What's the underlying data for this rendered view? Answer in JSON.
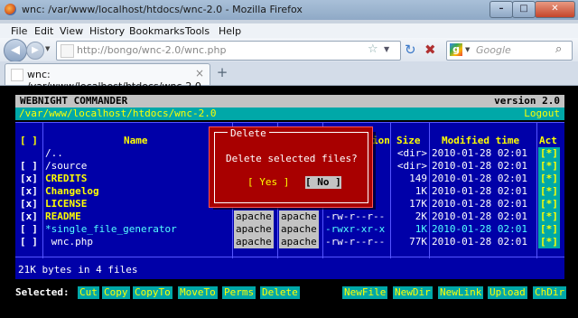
{
  "window": {
    "title": "wnc: /var/www/localhost/htdocs/wnc-2.0 - Mozilla Firefox",
    "min": "–",
    "max": "□",
    "close": "✕"
  },
  "menu": [
    "File",
    "Edit",
    "View",
    "History",
    "Bookmarks",
    "Tools",
    "Help"
  ],
  "nav": {
    "url": "http://bongo/wnc-2.0/wnc.php",
    "search_placeholder": "Google",
    "back": "◀",
    "forward": "▶",
    "reload": "↻",
    "stop": "✖"
  },
  "tab": {
    "label": "wnc: /var/www/localhost/htdocs/wnc-2.0",
    "close": "×",
    "new": "+"
  },
  "app": {
    "name": "WEBNIGHT COMMANDER",
    "version": "version 2.0",
    "path": "/var/www/localhost/htdocs/wnc-2.0",
    "logout": "Logout",
    "columns": {
      "sel": "[ ]",
      "name": "Name",
      "perm": "ion",
      "size": "Size",
      "modified": "Modified time",
      "act": "Act"
    },
    "rows": [
      {
        "sel": "",
        "name": "/..",
        "owner": "",
        "group": "",
        "perm": "-x",
        "size": "<dir>",
        "modified": "2010-01-28 02:01",
        "act": "[*]",
        "style": "plain"
      },
      {
        "sel": "[ ]",
        "name": "/source",
        "owner": "",
        "group": "",
        "perm": "-x",
        "size": "<dir>",
        "modified": "2010-01-28 02:01",
        "act": "[*]",
        "style": "plain"
      },
      {
        "sel": "[x]",
        "name": "CREDITS",
        "owner": "",
        "group": "",
        "perm": "--",
        "size": "149",
        "modified": "2010-01-28 02:01",
        "act": "[*]",
        "style": "fn"
      },
      {
        "sel": "[x]",
        "name": "Changelog",
        "owner": "",
        "group": "",
        "perm": "--",
        "size": "1K",
        "modified": "2010-01-28 02:01",
        "act": "[*]",
        "style": "fn"
      },
      {
        "sel": "[x]",
        "name": "LICENSE",
        "owner": "",
        "group": "",
        "perm": "--",
        "size": "17K",
        "modified": "2010-01-28 02:01",
        "act": "[*]",
        "style": "fn"
      },
      {
        "sel": "[x]",
        "name": "README",
        "owner": "apache",
        "group": "apache",
        "perm": "-rw-r--r--",
        "size": "2K",
        "modified": "2010-01-28 02:01",
        "act": "[*]",
        "style": "fn"
      },
      {
        "sel": "[ ]",
        "name": "*single_file_generator",
        "owner": "apache",
        "group": "apache",
        "perm": "-rwxr-xr-x",
        "size": "1K",
        "modified": "2010-01-28 02:01",
        "act": "[*]",
        "style": "cyan"
      },
      {
        "sel": "[ ]",
        "name": " wnc.php",
        "owner": "apache",
        "group": "apache",
        "perm": "-rw-r--r--",
        "size": "77K",
        "modified": "2010-01-28 02:01",
        "act": "[*]",
        "style": "plain"
      }
    ],
    "info": "21K bytes in 4 files",
    "dialog": {
      "title": "Delete",
      "message": "Delete selected files?",
      "yes": "[ Yes ]",
      "no": "[ No ]"
    },
    "bottom": {
      "label": "Selected:",
      "left_buttons": [
        "Cut",
        "Copy",
        "CopyTo",
        "MoveTo",
        "Perms",
        "Delete"
      ],
      "right_buttons": [
        "NewFile",
        "NewDir",
        "NewLink",
        "Upload",
        "ChDir"
      ]
    }
  },
  "icons": {
    "tab_icon": "page-icon",
    "bookmark": "star-icon",
    "search": "magnifier-icon"
  }
}
